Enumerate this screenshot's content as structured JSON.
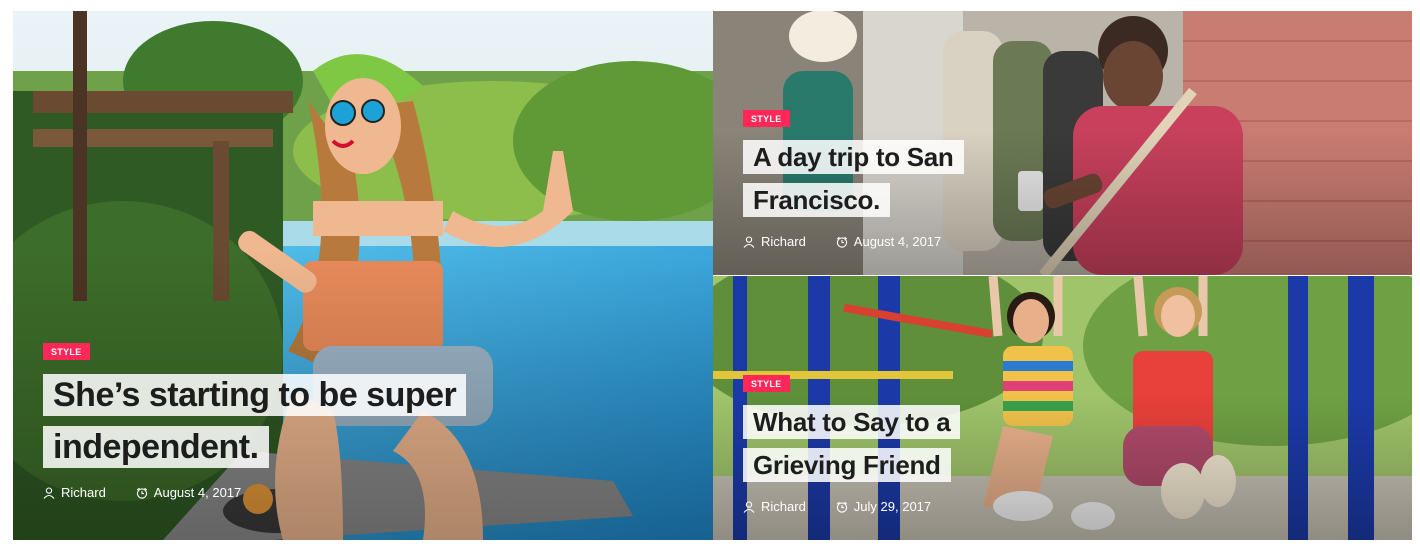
{
  "colors": {
    "badge": "#ff2757"
  },
  "posts": [
    {
      "category": "STYLE",
      "title": "She’s starting to be super independent.",
      "author": "Richard",
      "date": "August 4, 2017"
    },
    {
      "category": "STYLE",
      "title": "A day trip to San Francisco.",
      "author": "Richard",
      "date": "August 4, 2017"
    },
    {
      "category": "STYLE",
      "title": "What to Say to a Grieving Friend",
      "author": "Richard",
      "date": "July 29, 2017"
    }
  ]
}
